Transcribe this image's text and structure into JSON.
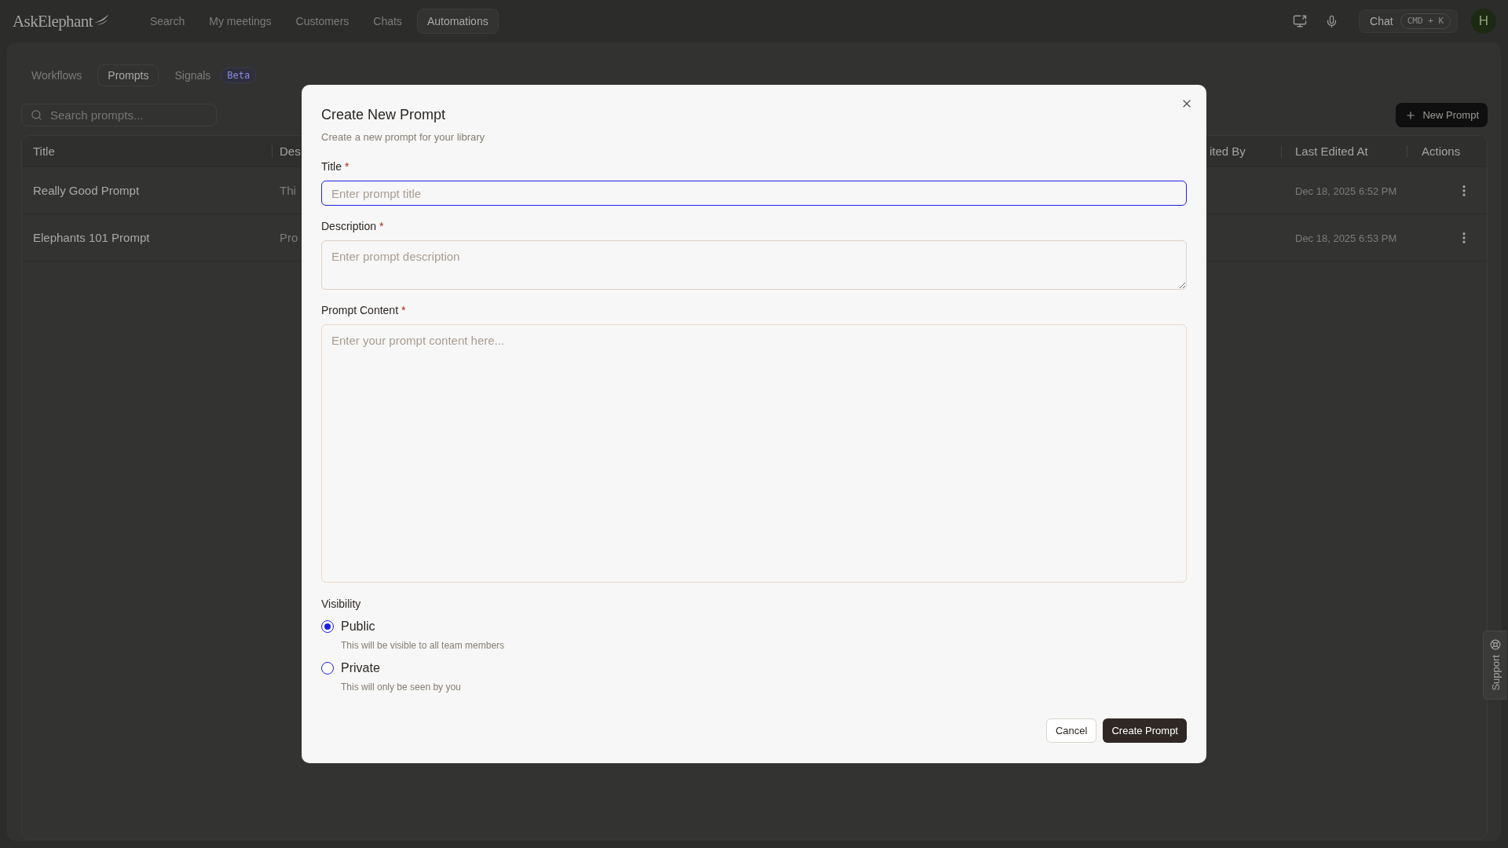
{
  "nav": {
    "logo": "AskElephant",
    "items": [
      {
        "label": "Search",
        "selected": false
      },
      {
        "label": "My meetings",
        "selected": false
      },
      {
        "label": "Customers",
        "selected": false
      },
      {
        "label": "Chats",
        "selected": false
      },
      {
        "label": "Automations",
        "selected": true
      }
    ],
    "chat": {
      "label": "Chat",
      "shortcut": "CMD + K"
    },
    "avatar": "H"
  },
  "tabs": [
    {
      "label": "Workflows",
      "selected": false
    },
    {
      "label": "Prompts",
      "selected": true
    },
    {
      "label": "Signals",
      "selected": false,
      "badge": "Beta"
    }
  ],
  "search": {
    "placeholder": "Search prompts..."
  },
  "new_button": {
    "label": "New Prompt"
  },
  "table": {
    "columns": [
      "Title",
      "Des",
      "ited By",
      "Last Edited At",
      "Actions"
    ],
    "rows": [
      {
        "title": "Really Good Prompt",
        "description": "Thi",
        "last_edited_at": "Dec 18, 2025 6:52 PM"
      },
      {
        "title": "Elephants 101 Prompt",
        "description": "Pro",
        "last_edited_at": "Dec 18, 2025 6:53 PM"
      }
    ]
  },
  "dialog": {
    "title": "Create New Prompt",
    "subtitle": "Create a new prompt for your library",
    "fields": [
      {
        "kind": "input",
        "label": "Title",
        "required_mark": "*",
        "placeholder": "Enter prompt title",
        "focused": true
      },
      {
        "kind": "textarea",
        "label": "Description",
        "required_mark": "*",
        "placeholder": "Enter prompt description",
        "focused": false
      },
      {
        "kind": "largetextarea",
        "label": "Prompt Content",
        "required_mark": "*",
        "placeholder": "Enter your prompt content here...",
        "focused": false
      }
    ],
    "visibility": {
      "label": "Visibility",
      "options": [
        {
          "label": "Public",
          "hint": "This will be visible to all team members",
          "selected": true
        },
        {
          "label": "Private",
          "hint": "This will only be seen by you",
          "selected": false
        }
      ]
    },
    "buttons": [
      {
        "kind": "secondary",
        "label": "Cancel"
      },
      {
        "kind": "primary",
        "label": "Create Prompt"
      }
    ]
  },
  "support": {
    "label": "Support"
  }
}
